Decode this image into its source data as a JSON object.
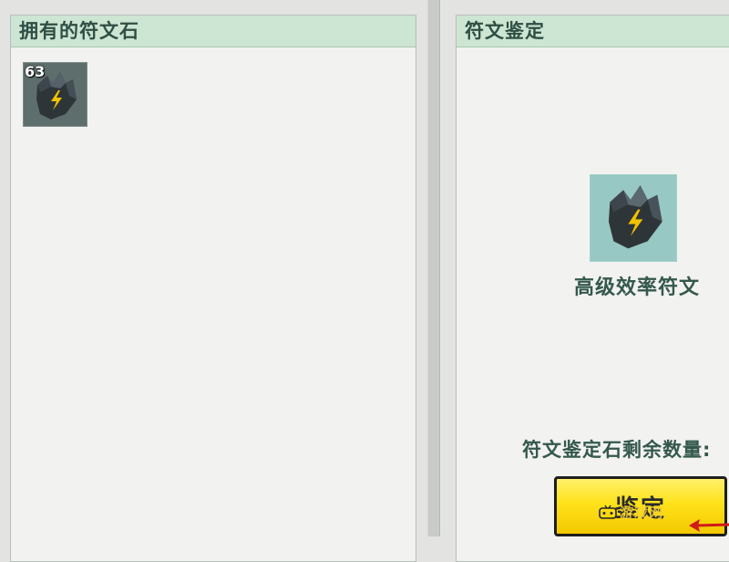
{
  "inventory": {
    "title": "拥有的符文石",
    "items": [
      {
        "icon": "lightning-rune-stone-icon",
        "count": "63"
      }
    ]
  },
  "identify": {
    "title": "符文鉴定",
    "selected_rune": {
      "icon": "lightning-rune-stone-icon",
      "name": "高级效率符文"
    },
    "remaining_label": "符文鉴定石剩余数量:",
    "button_label": "鉴定"
  },
  "watermark": {
    "icon": "game-controller-icon",
    "text": "游戏网"
  },
  "colors": {
    "panel_header_bg": "#cde5d3",
    "panel_header_text": "#2f4f44",
    "panel_bg": "#f2f2f1",
    "button_yellow": "#ffe21a",
    "arrow_red": "#d11a1a",
    "preview_bg": "#97c8c3"
  }
}
